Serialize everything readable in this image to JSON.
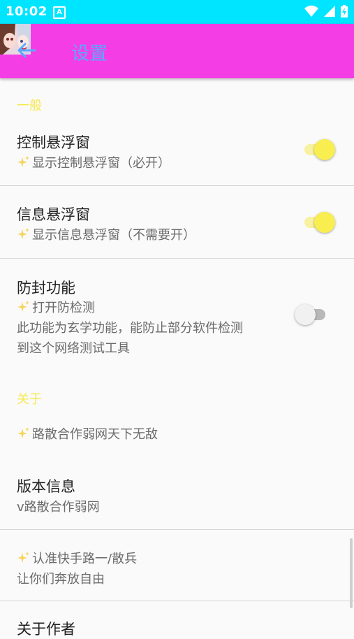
{
  "status_bar": {
    "time": "10:02",
    "notification_icon": "A"
  },
  "app_bar": {
    "title": "设置",
    "avatar_icon": "anime-avatar-icon",
    "back_icon": "back-arrow-icon"
  },
  "colors": {
    "status_bar": "#00e5ff",
    "app_bar": "#f53de6",
    "title": "#5aa9ff",
    "section": "#f7e94f",
    "switch_on": "#f9ee4f"
  },
  "sections": {
    "general": "一般",
    "about": "关于"
  },
  "items": {
    "floating_control": {
      "title": "控制悬浮窗",
      "subtitle": "显示控制悬浮窗（必开）",
      "enabled": true
    },
    "floating_info": {
      "title": "信息悬浮窗",
      "subtitle": "显示信息悬浮窗（不需要开）",
      "enabled": true
    },
    "anti_block": {
      "title": "防封功能",
      "subtitle": "打开防检测",
      "desc_line1": "此功能为玄学功能，能防止部分软件检测",
      "desc_line2": "到这个网络测试工具",
      "enabled": false
    },
    "about_line": {
      "subtitle": "路散合作弱网天下无敌"
    },
    "version": {
      "title": "版本信息",
      "subtitle": "v路散合作弱网"
    },
    "recognize": {
      "subtitle": "认准快手路一/散兵",
      "desc": "让你们奔放自由"
    },
    "author": {
      "title": "关于作者"
    }
  }
}
